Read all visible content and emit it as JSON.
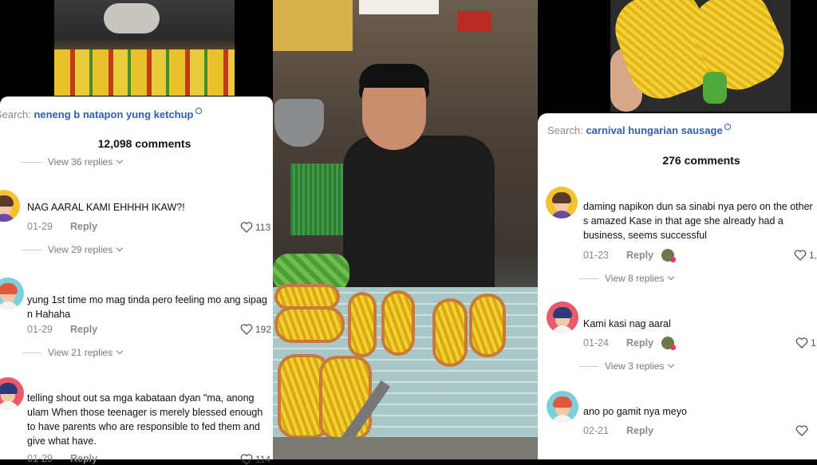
{
  "left_panel": {
    "search_label": "Search:",
    "search_query": "neneng b natapon yung ketchup",
    "comment_count": "12,098 comments",
    "top_replies": "View 36 replies",
    "comments": [
      {
        "text": "NAG AARAL KAMI EHHHH IKAW?!",
        "date": "01-29",
        "reply": "Reply",
        "likes": "113",
        "view_replies": "View 29 replies",
        "avatar_color": "#f2c230"
      },
      {
        "text": "yung 1st time mo mag tinda pero feeling mo ang sipag n Hahaha",
        "date": "01-29",
        "reply": "Reply",
        "likes": "192",
        "view_replies": "View 21 replies",
        "avatar_color": "#7ecfdc"
      },
      {
        "text": "telling shout out sa mga kabataan dyan \"ma, anong ulam When those teenager is merely blessed enough to have parents who are responsible to fed them and give what have.",
        "date": "01-29",
        "reply": "Reply",
        "likes": "114",
        "avatar_color": "#e95a6a"
      }
    ]
  },
  "right_panel": {
    "search_label": "Search:",
    "search_query": "carnival hungarian sausage",
    "comment_count": "276 comments",
    "comments": [
      {
        "text": "daming napikon dun sa sinabi nya pero on the other s amazed Kase in that age she already had a business, seems successful",
        "date": "01-23",
        "reply": "Reply",
        "likes": "1,",
        "view_replies": "View 8 replies",
        "avatar_color": "#f2c230"
      },
      {
        "text": "Kami kasi nag aaral",
        "date": "01-24",
        "reply": "Reply",
        "likes": "1",
        "view_replies": "View 3 replies",
        "avatar_color": "#e95a6a"
      },
      {
        "text": "ano po gamit nya meyo",
        "date": "02-21",
        "reply": "Reply",
        "likes": "",
        "avatar_color": "#7ecfdc"
      }
    ]
  },
  "colors": {
    "link_blue": "#2e5fb0",
    "muted": "#8a8a8a",
    "yellow_avatar": "#f2c230",
    "pink_avatar": "#e95a6a",
    "teal_avatar": "#7ecfdc"
  }
}
